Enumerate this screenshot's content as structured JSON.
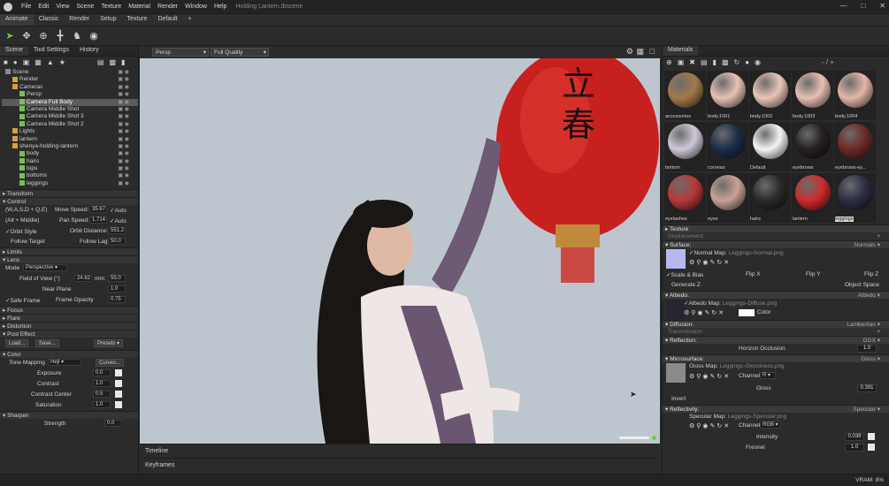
{
  "menubar": {
    "items": [
      "File",
      "Edit",
      "View",
      "Scene",
      "Texture",
      "Material",
      "Render",
      "Window",
      "Help"
    ],
    "doc_title": "Holding Lantern.tbscene"
  },
  "tabs": [
    "Animate",
    "Classic",
    "Render",
    "Setup",
    "Texture",
    "Default",
    "+"
  ],
  "left": {
    "tabs": [
      "Scene",
      "Tool Settings",
      "History"
    ],
    "tree": [
      {
        "label": "Scene",
        "indent": 0
      },
      {
        "label": "Render",
        "indent": 1
      },
      {
        "label": "Cameras",
        "indent": 1
      },
      {
        "label": "Persp",
        "indent": 2
      },
      {
        "label": "Camera Full Body",
        "indent": 2,
        "selected": true
      },
      {
        "label": "Camera Middle Shot",
        "indent": 2
      },
      {
        "label": "Camera Middle Shot 3",
        "indent": 2
      },
      {
        "label": "Camera Middle Shot 2",
        "indent": 2
      },
      {
        "label": "Lights",
        "indent": 1
      },
      {
        "label": "lantern",
        "indent": 1
      },
      {
        "label": "shenya-holding-lantern",
        "indent": 1
      },
      {
        "label": "body",
        "indent": 2
      },
      {
        "label": "hairs",
        "indent": 2
      },
      {
        "label": "tops",
        "indent": 2
      },
      {
        "label": "bottoms",
        "indent": 2
      },
      {
        "label": "leggings",
        "indent": 2
      }
    ],
    "transform": "Transform",
    "control": {
      "title": "Control",
      "wasd": "(W,A,S,D + Q,E)",
      "move_speed_label": "Move Speed:",
      "move_speed": "35.67",
      "auto1": "Auto",
      "alt_middle": "(Alt + Middle)",
      "pan_speed_label": "Pan Speed:",
      "pan_speed": "1.714",
      "auto2": "Auto",
      "orbit_style": "Orbit Style",
      "orbit_distance_label": "Orbit Distance:",
      "orbit_distance": "551.2",
      "follow_target": "Follow Target",
      "follow_lag_label": "Follow Lag",
      "follow_lag": "50.0"
    },
    "limits": "Limits",
    "lens": {
      "title": "Lens",
      "mode_label": "Mode",
      "mode_value": "Perspective",
      "fov_label": "Field of View (°)",
      "fov_value": "24.62",
      "mm_label": "mm:",
      "mm_value": "55.0",
      "near_plane_label": "Near Plane",
      "near_plane_value": "1.0",
      "safe_frame": "Safe Frame",
      "frame_opacity_label": "Frame Opacity",
      "frame_opacity_value": "0.75"
    },
    "focus": "Focus",
    "flare": "Flare",
    "distortion": "Distortion",
    "post_effect": {
      "title": "Post Effect",
      "load": "Load...",
      "save": "Save...",
      "presets": "Presets"
    },
    "color": {
      "title": "Color",
      "tone_mapping_label": "Tone Mapping",
      "tone_mapping_value": "Hejl",
      "curves": "Curves...",
      "exposure_label": "Exposure",
      "exposure_value": "0.0",
      "contrast_label": "Contrast",
      "contrast_value": "1.0",
      "contrast_center_label": "Contrast Center",
      "contrast_center_value": "0.5",
      "saturation_label": "Saturation",
      "saturation_value": "1.0"
    },
    "sharpen": {
      "title": "Sharpen",
      "strength_label": "Strength",
      "strength_value": "0.0"
    }
  },
  "viewport": {
    "camera": "Persp",
    "quality": "Full Quality",
    "lantern_text": "立春"
  },
  "bottom": {
    "timeline": "Timeline",
    "keyframes": "Keyframes"
  },
  "right": {
    "title": "Materials",
    "slot_indicator": "- / +",
    "materials": [
      {
        "name": "accessories",
        "color": "#a17a4a"
      },
      {
        "name": "body.1001",
        "color": "#e8c2b4"
      },
      {
        "name": "body.1002",
        "color": "#e9c6b8"
      },
      {
        "name": "body.1003",
        "color": "#e7c0b3"
      },
      {
        "name": "body.1004",
        "color": "#e3b6a9"
      },
      {
        "name": "bottom",
        "color": "#cfc9d8"
      },
      {
        "name": "corneas",
        "color": "#1b2e4a"
      },
      {
        "name": "Default",
        "color": "#f4f4f4"
      },
      {
        "name": "eyebrows",
        "color": "#262020"
      },
      {
        "name": "eyebrows-ey...",
        "color": "#6d2a26"
      },
      {
        "name": "eyelashes",
        "color": "#b93838"
      },
      {
        "name": "eyes",
        "color": "#c9a196"
      },
      {
        "name": "hairs",
        "color": "#2a2a2a"
      },
      {
        "name": "lantern",
        "color": "#cf2b2b"
      },
      {
        "name": "leggings",
        "color": "#2c2e44",
        "selected": true
      }
    ],
    "texture": "Texture",
    "displacement": "Displacement:",
    "surface": {
      "title": "Surface:",
      "value": "Normals",
      "normal_map": "Normal Map:",
      "normal_file": "Leggings-Normal.png",
      "scale_bias": "Scale & Bias",
      "flip_x": "Flip X",
      "flip_y": "Flip Y",
      "flip_z": "Flip Z",
      "generate_z": "Generate Z",
      "object_space": "Object Space"
    },
    "albedo": {
      "title": "Albedo:",
      "value": "Albedo",
      "map": "Albedo Map:",
      "file": "Leggings-Diffuse.png",
      "color_label": "Color"
    },
    "diffusion": {
      "title": "Diffusion:",
      "value": "Lambertian"
    },
    "transmission": "Transmission:",
    "reflection": {
      "title": "Reflection:",
      "value": "GGX",
      "horizon_label": "Horizon Occlusion",
      "horizon_value": "1.0"
    },
    "microsurface": {
      "title": "Microsurface:",
      "value": "Gloss",
      "map": "Gloss Map:",
      "file": "Leggings-Glossiness.png",
      "channel_label": "Channel",
      "channel_value": "R",
      "gloss_label": "Gloss",
      "gloss_value": "0.391",
      "invert": "Invert"
    },
    "reflectivity": {
      "title": "Reflectivity:",
      "value": "Specular",
      "map": "Specular Map:",
      "file": "Leggings-Specular.png",
      "channel_label": "Channel",
      "channel_value": "RGB",
      "intensity_label": "Intensity",
      "intensity_value": "0.039",
      "fresnel_label": "Fresnel",
      "fresnel_value": "1.0"
    }
  },
  "status": {
    "vram": "VRAM: 8%"
  }
}
